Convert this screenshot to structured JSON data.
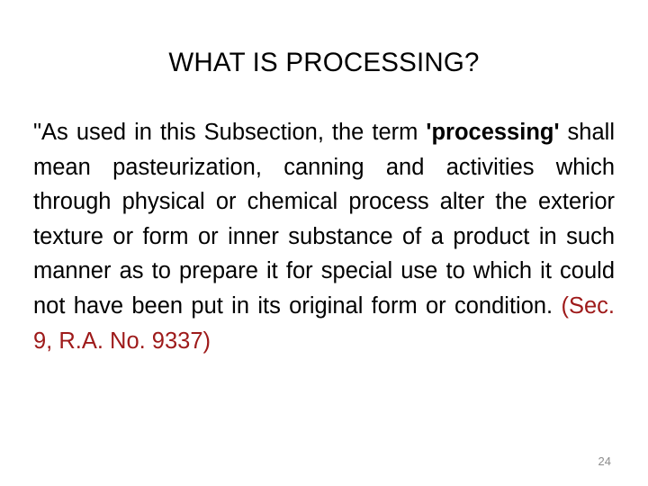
{
  "slide": {
    "title": "WHAT IS PROCESSING?",
    "page_number": "24",
    "colors": {
      "background": "#ffffff",
      "title": "#000000",
      "body": "#000000",
      "citation": "#9e1a1a",
      "page_number": "#8c8c8c"
    },
    "body": {
      "full_text": "\"As used in this Subsection, the term 'processing' shall mean pasteurization, canning and activities which through physical or chemical process alter the exterior texture or form or inner substance of a product in such manner as to prepare it for special use to which it could not have been put in its original form or condition. (Sec. 9, R.A. No. 9337)",
      "segments": {
        "lead_in": "\"As used in this Subsection, the term ",
        "emphasized_term": "'processing'",
        "continuation": " shall mean pasteurization, canning and activities which through physical or chemical process alter the exterior texture or form or inner substance of a product in such manner as to prepare it for special use to which it could not have been put in its original form or condition. ",
        "citation": "(Sec. 9, R.A. No. 9337)"
      },
      "rendered_lines": [
        "\"As used in this Subsection, the term",
        "'processing' shall mean pasteurization, canning",
        "and activities which through physical or",
        "chemical process alter the exterior texture or",
        "form or inner substance of a product in such",
        "manner as to prepare it for special use to which",
        "it could not have been put in its original form or",
        "condition. (Sec. 9, R.A. No. 9337)"
      ]
    }
  }
}
